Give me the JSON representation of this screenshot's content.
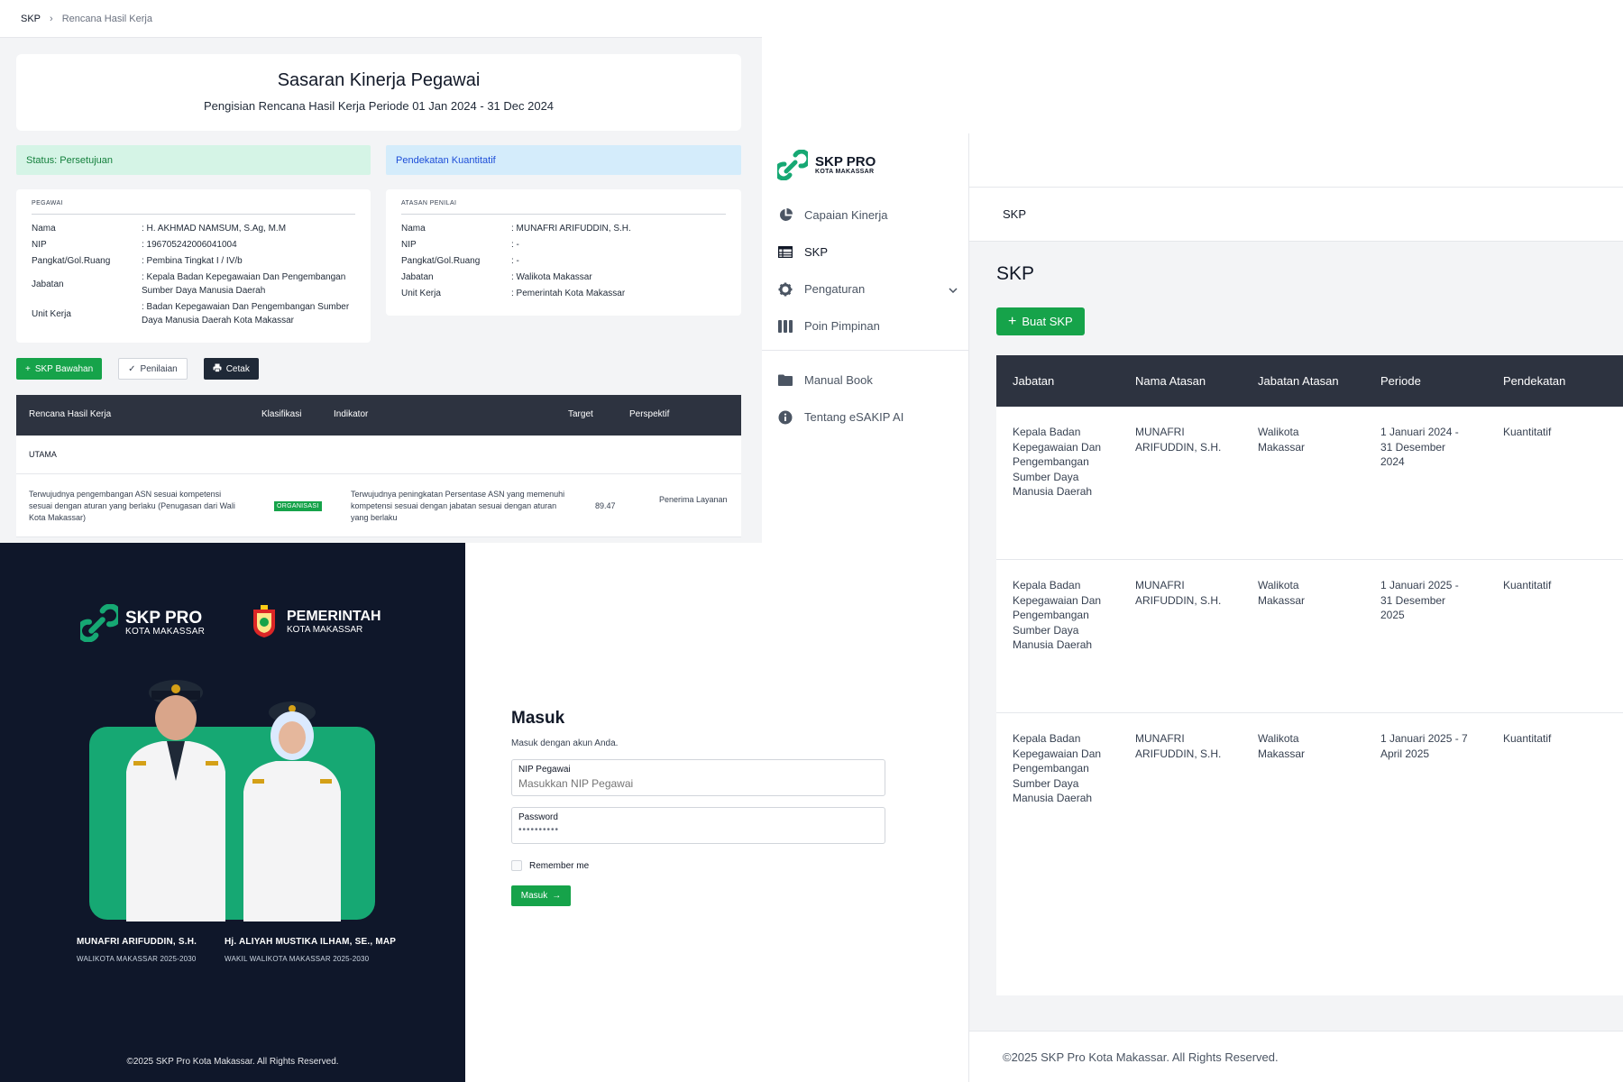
{
  "detail": {
    "breadcrumb": {
      "root": "SKP",
      "sep": "›",
      "current": "Rencana Hasil Kerja"
    },
    "title": "Sasaran Kinerja Pegawai",
    "subtitle": "Pengisian Rencana Hasil Kerja Periode 01 Jan 2024 - 31 Dec 2024",
    "status_label": "Status: Persetujuan",
    "approach_label": "Pendekatan Kuantitatif",
    "pegawai": {
      "title": "PEGAWAI",
      "rows": [
        {
          "k": "Nama",
          "v": ": H. AKHMAD NAMSUM, S.Ag, M.M"
        },
        {
          "k": "NIP",
          "v": ": 196705242006041004"
        },
        {
          "k": "Pangkat/Gol.Ruang",
          "v": ": Pembina Tingkat I / IV/b"
        },
        {
          "k": "Jabatan",
          "v": ": Kepala Badan Kepegawaian Dan Pengembangan Sumber Daya Manusia Daerah"
        },
        {
          "k": "Unit Kerja",
          "v": ": Badan Kepegawaian Dan Pengembangan Sumber Daya Manusia Daerah Kota Makassar"
        }
      ]
    },
    "atasan": {
      "title": "ATASAN PENILAI",
      "rows": [
        {
          "k": "Nama",
          "v": ": MUNAFRI ARIFUDDIN, S.H."
        },
        {
          "k": "NIP",
          "v": ": -"
        },
        {
          "k": "Pangkat/Gol.Ruang",
          "v": ": -"
        },
        {
          "k": "Jabatan",
          "v": ": Walikota Makassar"
        },
        {
          "k": "Unit Kerja",
          "v": ": Pemerintah Kota Makassar"
        }
      ]
    },
    "buttons": {
      "bawahan": "SKP Bawahan",
      "penilaian": "Penilaian",
      "cetak": "Cetak"
    },
    "table": {
      "headers": [
        "Rencana Hasil Kerja",
        "Klasifikasi",
        "Indikator",
        "Target",
        "Perspektif"
      ],
      "group": "UTAMA",
      "row": {
        "rhk": "Terwujudnya pengembangan ASN sesuai kompetensi sesuai dengan aturan yang berlaku (Penugasan dari Wali Kota Makassar)",
        "klasifikasi": "ORGANISASI",
        "indikator": "Terwujudnya peningkatan Persentase ASN yang memenuhi kompetensi sesuai dengan jabatan sesuai dengan aturan yang berlaku",
        "target": "89.47",
        "perspektif": "Penerima Layanan"
      }
    }
  },
  "list": {
    "logo": {
      "title": "SKP PRO",
      "sub": "KOTA MAKASSAR"
    },
    "nav": [
      "Capaian Kinerja",
      "SKP",
      "Pengaturan",
      "Poin Pimpinan"
    ],
    "nav2": [
      "Manual Book",
      "Tentang eSAKIP AI"
    ],
    "subheader": "SKP",
    "page_title": "SKP",
    "create_button": "Buat SKP",
    "headers": [
      "Jabatan",
      "Nama Atasan",
      "Jabatan Atasan",
      "Periode",
      "Pendekatan"
    ],
    "rows": [
      {
        "jabatan": "Kepala Badan Kepegawaian Dan Pengembangan Sumber Daya Manusia Daerah",
        "atasan": "MUNAFRI ARIFUDDIN, S.H.",
        "jab_atasan": "Walikota Makassar",
        "periode": "1 Januari 2024 - 31 Desember 2024",
        "pendekatan": "Kuantitatif"
      },
      {
        "jabatan": "Kepala Badan Kepegawaian Dan Pengembangan Sumber Daya Manusia Daerah",
        "atasan": "MUNAFRI ARIFUDDIN, S.H.",
        "jab_atasan": "Walikota Makassar",
        "periode": "1 Januari 2025 - 31 Desember 2025",
        "pendekatan": "Kuantitatif"
      },
      {
        "jabatan": "Kepala Badan Kepegawaian Dan Pengembangan Sumber Daya Manusia Daerah",
        "atasan": "MUNAFRI ARIFUDDIN, S.H.",
        "jab_atasan": "Walikota Makassar",
        "periode": "1 Januari 2025 - 7 April 2025",
        "pendekatan": "Kuantitatif"
      }
    ],
    "footer": "©2025 SKP Pro Kota Makassar. All Rights Reserved."
  },
  "login": {
    "brand": {
      "title": "SKP PRO",
      "sub": "KOTA MAKASSAR"
    },
    "gov": {
      "title": "PEMERINTAH",
      "sub": "KOTA MAKASSAR"
    },
    "people": [
      {
        "name": "MUNAFRI ARIFUDDIN, S.H.",
        "role": "WALIKOTA MAKASSAR 2025-2030"
      },
      {
        "name": "Hj. ALIYAH MUSTIKA ILHAM, SE., MAP",
        "role": "WAKIL WALIKOTA MAKASSAR 2025-2030"
      }
    ],
    "copyright": "©2025 SKP Pro Kota Makassar. All Rights Reserved.",
    "heading": "Masuk",
    "subheading": "Masuk dengan akun Anda.",
    "nip_label": "NIP Pegawai",
    "nip_placeholder": "Masukkan NIP Pegawai",
    "password_label": "Password",
    "password_value": "••••••••••",
    "remember": "Remember me",
    "submit": "Masuk"
  },
  "colors": {
    "brand_green": "#16a34a",
    "dark_header": "#2d3340",
    "login_bg": "#0f172a",
    "photo_bg": "#16a873"
  }
}
